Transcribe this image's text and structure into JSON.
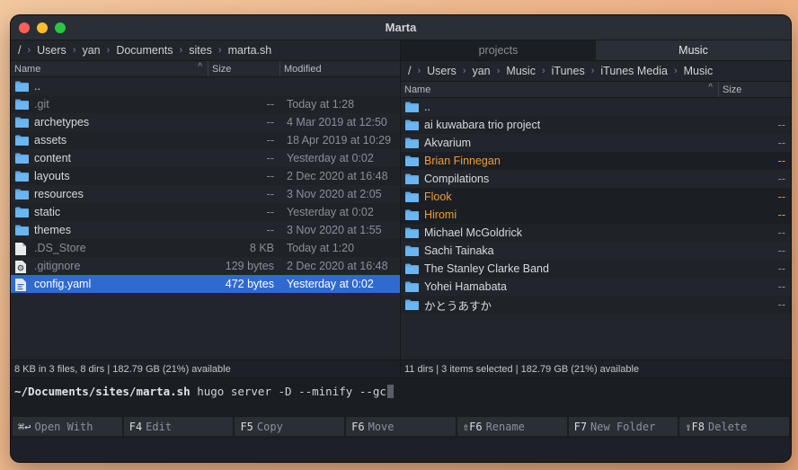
{
  "window": {
    "title": "Marta"
  },
  "colors": {
    "selection": "#2f6ad0",
    "marked": "#f29a3c",
    "folder": "#5aa8e8",
    "traffic_red": "#ff5f57",
    "traffic_yellow": "#febc2e",
    "traffic_green": "#28c840"
  },
  "left": {
    "breadcrumb": [
      "/",
      "Users",
      "yan",
      "Documents",
      "sites",
      "marta.sh"
    ],
    "columns": {
      "name": "Name",
      "size": "Size",
      "modified": "Modified"
    },
    "rows": [
      {
        "name": "..",
        "size": "",
        "modified": "",
        "icon": "folder-icon"
      },
      {
        "name": ".git",
        "size": "--",
        "modified": "Today at 1:28",
        "icon": "folder-icon",
        "hidden": true
      },
      {
        "name": "archetypes",
        "size": "--",
        "modified": "4 Mar 2019 at 12:50",
        "icon": "folder-icon"
      },
      {
        "name": "assets",
        "size": "--",
        "modified": "18 Apr 2019 at 10:29",
        "icon": "folder-icon"
      },
      {
        "name": "content",
        "size": "--",
        "modified": "Yesterday at 0:02",
        "icon": "folder-icon"
      },
      {
        "name": "layouts",
        "size": "--",
        "modified": "2 Dec 2020 at 16:48",
        "icon": "folder-icon"
      },
      {
        "name": "resources",
        "size": "--",
        "modified": "3 Nov 2020 at 2:05",
        "icon": "folder-icon"
      },
      {
        "name": "static",
        "size": "--",
        "modified": "Yesterday at 0:02",
        "icon": "folder-icon"
      },
      {
        "name": "themes",
        "size": "--",
        "modified": "3 Nov 2020 at 1:55",
        "icon": "folder-icon"
      },
      {
        "name": ".DS_Store",
        "size": "8 KB",
        "modified": "Today at 1:20",
        "icon": "file-icon",
        "hidden": true
      },
      {
        "name": ".gitignore",
        "size": "129 bytes",
        "modified": "2 Dec 2020 at 16:48",
        "icon": "gear-file-icon",
        "hidden": true
      },
      {
        "name": "config.yaml",
        "size": "472 bytes",
        "modified": "Yesterday at 0:02",
        "icon": "yaml-file-icon",
        "selected": true
      }
    ],
    "status": "8 KB in 3 files, 8 dirs  |  182.79 GB (21%) available"
  },
  "right": {
    "tabs": [
      {
        "label": "projects",
        "active": false
      },
      {
        "label": "Music",
        "active": true
      }
    ],
    "breadcrumb": [
      "/",
      "Users",
      "yan",
      "Music",
      "iTunes",
      "iTunes Media",
      "Music"
    ],
    "columns": {
      "name": "Name",
      "size": "Size"
    },
    "rows": [
      {
        "name": "..",
        "size": ""
      },
      {
        "name": "ai kuwabara trio project",
        "size": "--"
      },
      {
        "name": "Akvarium",
        "size": "--"
      },
      {
        "name": "Brian Finnegan",
        "size": "--",
        "marked": true
      },
      {
        "name": "Compilations",
        "size": "--"
      },
      {
        "name": "Flook",
        "size": "--",
        "marked": true
      },
      {
        "name": "Hiromi",
        "size": "--",
        "marked": true
      },
      {
        "name": "Michael McGoldrick",
        "size": "--"
      },
      {
        "name": "Sachi Tainaka",
        "size": "--"
      },
      {
        "name": "The Stanley Clarke Band",
        "size": "--"
      },
      {
        "name": "Yohei Hamabata",
        "size": "--"
      },
      {
        "name": "かとうあすか",
        "size": "--"
      }
    ],
    "status": "11 dirs  |  3 items selected  |  182.79 GB (21%) available"
  },
  "terminal": {
    "path": "~/Documents/sites/marta.sh",
    "command": " hugo server -D --minify --gc"
  },
  "fnkeys": [
    {
      "key": "⌘↩",
      "label": "Open With"
    },
    {
      "key": "F4",
      "label": "Edit"
    },
    {
      "key": "F5",
      "label": "Copy"
    },
    {
      "key": "F6",
      "label": "Move"
    },
    {
      "key": "⇧F6",
      "label": "Rename"
    },
    {
      "key": "F7",
      "label": "New Folder"
    },
    {
      "key": "⇧F8",
      "label": "Delete"
    }
  ]
}
